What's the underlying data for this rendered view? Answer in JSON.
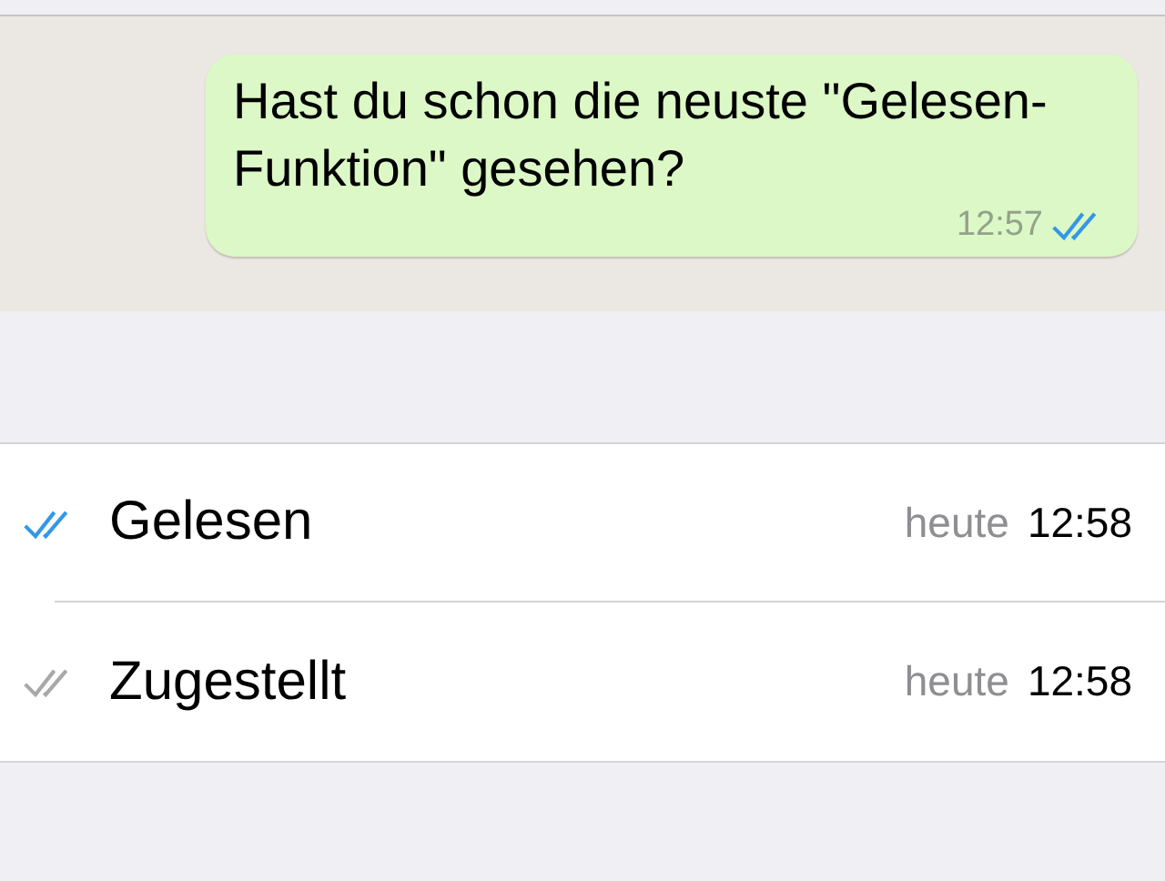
{
  "message": {
    "text": "Hast du schon die neuste \"Gelesen-Funktion\" gesehen?",
    "time": "12:57",
    "kind": "read"
  },
  "receipts": [
    {
      "kind": "read",
      "label": "Gelesen",
      "day": "heute",
      "time": "12:58"
    },
    {
      "kind": "delivered",
      "label": "Zugestellt",
      "day": "heute",
      "time": "12:58"
    }
  ]
}
